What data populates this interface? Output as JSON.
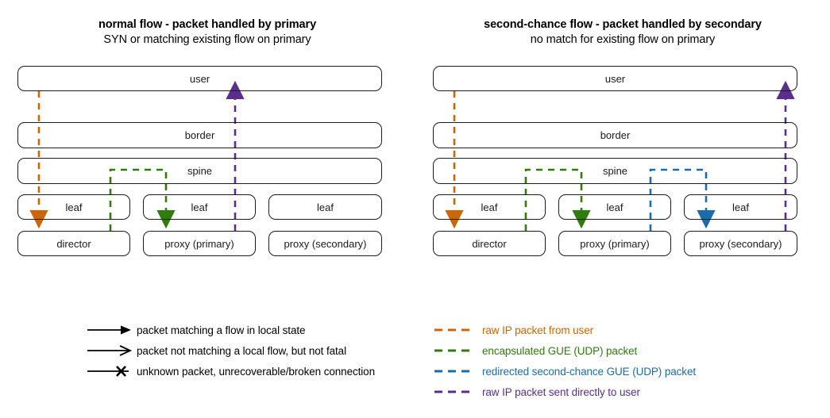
{
  "panels": [
    {
      "id": "normal-flow",
      "title": "normal flow - packet handled by primary",
      "subtitle": "SYN or matching existing flow on primary",
      "rows": [
        {
          "name": "user",
          "boxes": [
            {
              "label": "user"
            }
          ]
        },
        {
          "name": "border",
          "boxes": [
            {
              "label": "border"
            }
          ]
        },
        {
          "name": "spine",
          "boxes": [
            {
              "label": "spine"
            }
          ]
        },
        {
          "name": "leaf",
          "boxes": [
            {
              "label": "leaf"
            },
            {
              "label": "leaf"
            },
            {
              "label": "leaf"
            }
          ]
        },
        {
          "name": "hosts",
          "boxes": [
            {
              "label": "director"
            },
            {
              "label": "proxy (primary)"
            },
            {
              "label": "proxy (secondary)"
            }
          ]
        }
      ],
      "flows": [
        {
          "name": "raw-ip-from-user-to-director",
          "color": "#cc6600",
          "head": "down"
        },
        {
          "name": "encapsulated-gue-to-proxy-primary",
          "color": "#2e7d0e",
          "head": "down"
        },
        {
          "name": "raw-ip-direct-to-user",
          "color": "#5b2d8e",
          "head": "up"
        }
      ]
    },
    {
      "id": "second-chance-flow",
      "title": "second-chance flow - packet handled by secondary",
      "subtitle": "no match for existing flow on primary",
      "rows": [
        {
          "name": "user",
          "boxes": [
            {
              "label": "user"
            }
          ]
        },
        {
          "name": "border",
          "boxes": [
            {
              "label": "border"
            }
          ]
        },
        {
          "name": "spine",
          "boxes": [
            {
              "label": "spine"
            }
          ]
        },
        {
          "name": "leaf",
          "boxes": [
            {
              "label": "leaf"
            },
            {
              "label": "leaf"
            },
            {
              "label": "leaf"
            }
          ]
        },
        {
          "name": "hosts",
          "boxes": [
            {
              "label": "director"
            },
            {
              "label": "proxy (primary)"
            },
            {
              "label": "proxy (secondary)"
            }
          ]
        }
      ],
      "flows": [
        {
          "name": "raw-ip-from-user-to-director",
          "color": "#cc6600",
          "head": "down"
        },
        {
          "name": "encapsulated-gue-to-proxy-primary",
          "color": "#2e7d0e",
          "head": "down"
        },
        {
          "name": "redirected-second-chance-to-proxy-secondary",
          "color": "#1b6ca8",
          "head": "down"
        },
        {
          "name": "raw-ip-direct-to-user",
          "color": "#5b2d8e",
          "head": "up"
        }
      ]
    }
  ],
  "legend_shapes": {
    "items": [
      {
        "marker": "filled-arrowhead",
        "label": "packet matching a flow in local state"
      },
      {
        "marker": "open-arrowhead",
        "label": "packet not matching a local flow, but not fatal"
      },
      {
        "marker": "cross-mark",
        "label": "unknown packet, unrecoverable/broken connection"
      }
    ]
  },
  "legend_colors": {
    "items": [
      {
        "color": "#cc6600",
        "label": "raw IP packet from user"
      },
      {
        "color": "#2e7d0e",
        "label": "encapsulated GUE (UDP) packet"
      },
      {
        "color": "#1b6ca8",
        "label": "redirected second-chance GUE (UDP) packet"
      },
      {
        "color": "#5b2d8e",
        "label": "raw IP packet sent directly to user"
      }
    ]
  }
}
